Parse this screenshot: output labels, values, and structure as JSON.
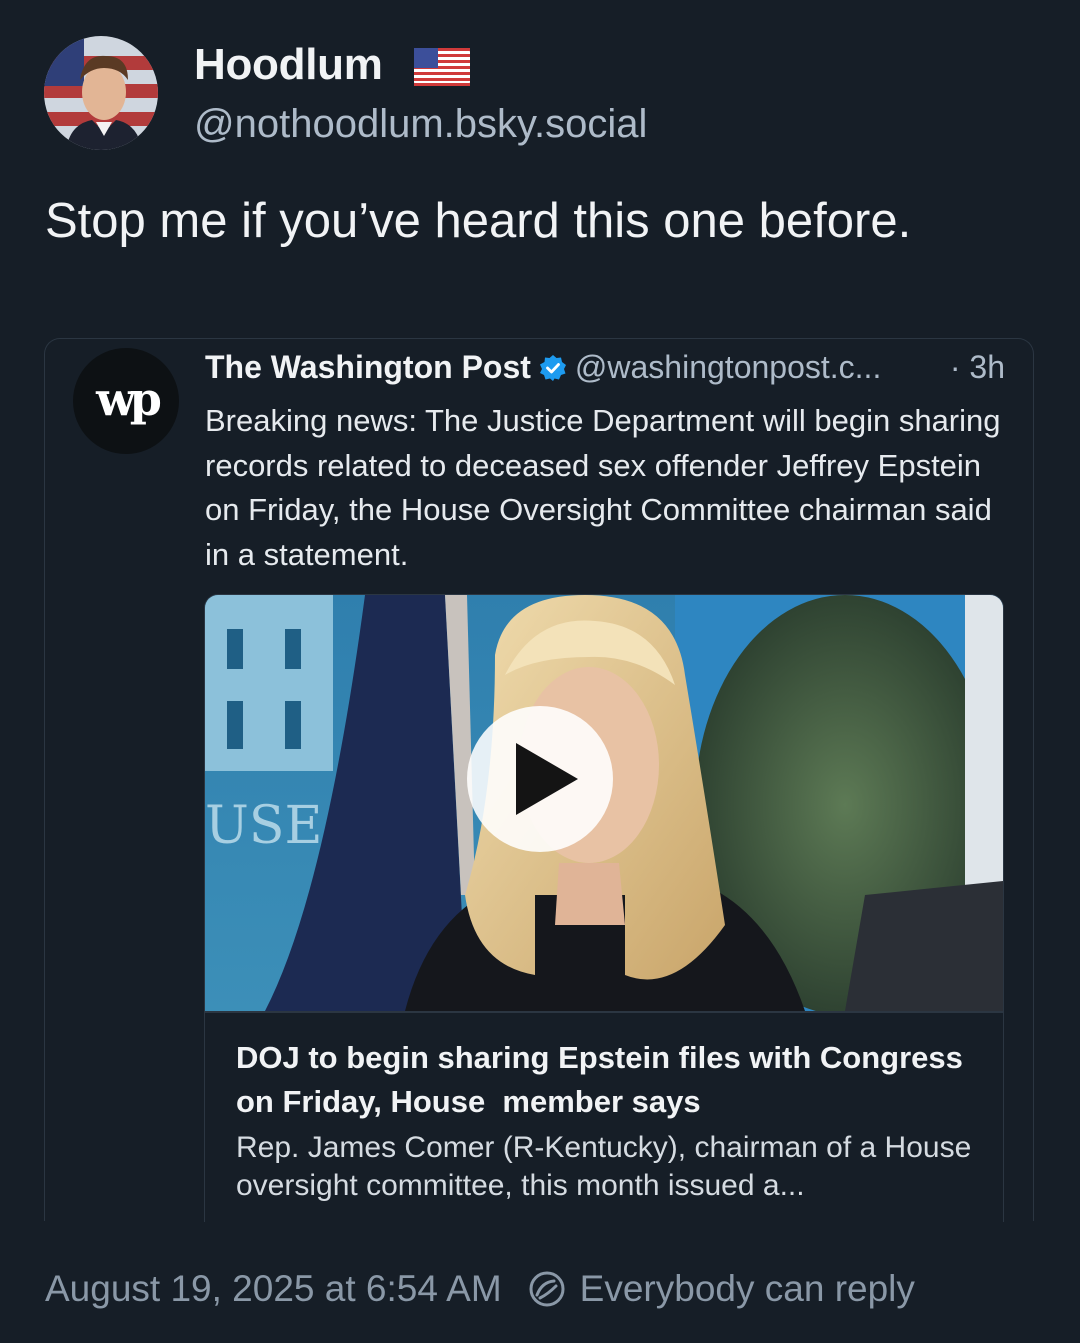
{
  "author": {
    "display_name": "Hoodlum",
    "flag_emoji_name": "us-flag-icon",
    "handle": "@nothoodlum.bsky.social"
  },
  "post": {
    "text": "Stop me if you’ve heard this one before."
  },
  "quote": {
    "logo_text": "wp",
    "name": "The Washington Post",
    "handle": "@washingtonpost.c...",
    "time": "· 3h",
    "text": "Breaking news: The Justice Department will begin sharing records related to deceased sex offender Jeffrey Epstein on Friday, the House Oversight Committee chairman said in a statement.",
    "embed": {
      "title": "DOJ to begin sharing Epstein files with Congress on Friday, House  member says",
      "description": "Rep. James Comer (R-Kentucky), chairman of a House oversight committee, this month issued a...",
      "image_sign_text": "USE"
    }
  },
  "footer": {
    "timestamp": "August 19, 2025 at 6:54 AM",
    "reply_setting": "Everybody can reply"
  },
  "colors": {
    "background": "#161e27",
    "text_primary": "#f1f3f5",
    "text_secondary": "#aebbc9",
    "footer_text": "#8a98a7",
    "border": "#2b3642",
    "verified": "#1d9bf0"
  }
}
